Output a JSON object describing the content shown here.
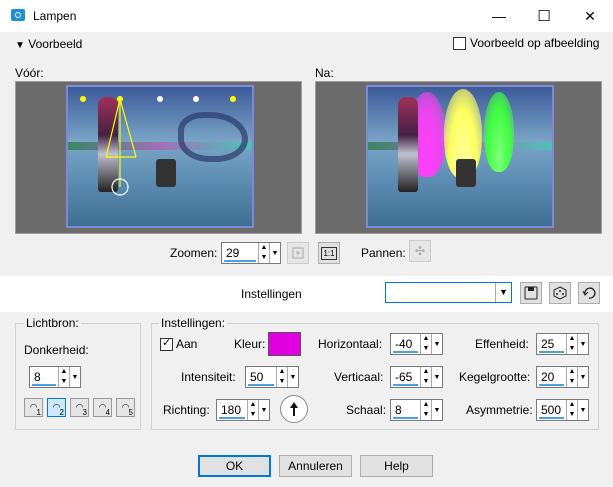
{
  "window": {
    "title": "Lampen",
    "minimize": "—",
    "maximize": "☐",
    "close": "✕"
  },
  "preview_section": {
    "toggle_label": "Voorbeeld",
    "toggle_arrow": "▼",
    "preview_on_image_label": "Voorbeeld op afbeelding",
    "before_label": "Vóór:",
    "after_label": "Na:"
  },
  "zoom": {
    "label": "Zoomen:",
    "value": "29",
    "pan_label": "Pannen:",
    "zoom_actual": "1:1"
  },
  "settings_bar": {
    "label": "Instellingen",
    "preset_value": ""
  },
  "lightsource": {
    "group_label": "Lichtbron:",
    "darkness_label": "Donkerheid:",
    "darkness_value": "8",
    "lights": [
      "1",
      "2",
      "3",
      "4",
      "5"
    ]
  },
  "settings": {
    "group_label": "Instellingen:",
    "on_label": "Aan",
    "color_label": "Kleur:",
    "color_value": "#e000e0",
    "horizontal_label": "Horizontaal:",
    "horizontal_value": "-40",
    "softness_label": "Effenheid:",
    "softness_value": "25",
    "intensity_label": "Intensiteit:",
    "intensity_value": "50",
    "vertical_label": "Verticaal:",
    "vertical_value": "-65",
    "cone_label": "Kegelgrootte:",
    "cone_value": "20",
    "direction_label": "Richting:",
    "direction_value": "180",
    "scale_label": "Schaal:",
    "scale_value": "8",
    "asymmetry_label": "Asymmetrie:",
    "asymmetry_value": "500"
  },
  "buttons": {
    "ok": "OK",
    "cancel": "Annuleren",
    "help": "Help"
  },
  "colors": {
    "accent": "#0078d7"
  }
}
